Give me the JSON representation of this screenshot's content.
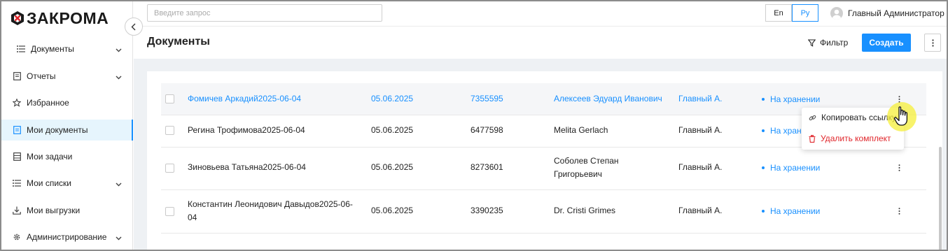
{
  "app": {
    "logo_text": "ЗАКРОМА"
  },
  "search": {
    "placeholder": "Введите запрос"
  },
  "languages": [
    {
      "label": "En"
    },
    {
      "label": "Ру"
    }
  ],
  "user": {
    "name": "Главный Администратор"
  },
  "page": {
    "title": "Документы",
    "filter_label": "Фильтр",
    "create_label": "Создать"
  },
  "sidebar": {
    "items": [
      {
        "label": "Документы",
        "icon": "list-icon",
        "expandable": true
      },
      {
        "label": "Отчеты",
        "icon": "report-icon",
        "expandable": true
      },
      {
        "label": "Избранное",
        "icon": "star-icon",
        "expandable": false
      },
      {
        "label": "Мои документы",
        "icon": "document-icon",
        "expandable": false,
        "active": true
      },
      {
        "label": "Мои задачи",
        "icon": "tasks-icon",
        "expandable": false
      },
      {
        "label": "Мои списки",
        "icon": "list-icon",
        "expandable": true
      },
      {
        "label": "Мои выгрузки",
        "icon": "download-icon",
        "expandable": false
      },
      {
        "label": "Администрирование",
        "icon": "gear-icon",
        "expandable": true
      }
    ]
  },
  "table": {
    "rows": [
      {
        "name": "Фомичев Аркадий2025-06-04",
        "date": "05.06.2025",
        "number": "7355595",
        "person": "Алексеев Эдуард Иванович",
        "owner": "Главный А.",
        "status": "На хранении"
      },
      {
        "name": "Регина Трофимова2025-06-04",
        "date": "05.06.2025",
        "number": "6477598",
        "person": "Melita Gerlach",
        "owner": "Главный А.",
        "status": "На хранении"
      },
      {
        "name": "Зиновьева Татьяна2025-06-04",
        "date": "05.06.2025",
        "number": "8273601",
        "person": "Соболев Степан Григорьевич",
        "owner": "Главный А.",
        "status": "На хранении"
      },
      {
        "name": "Константин Леонидович Давыдов2025-06-04",
        "date": "05.06.2025",
        "number": "3390235",
        "person": "Dr. Cristi Grimes",
        "owner": "Главный А.",
        "status": "На хранении"
      }
    ]
  },
  "context_menu": {
    "copy_label": "Копировать ссылку",
    "delete_label": "Удалить комплект",
    "delete_color": "#e0262b"
  },
  "colors": {
    "accent": "#1890ff",
    "active_bg": "#e6f5fd",
    "content_bg": "#eef1f4"
  }
}
